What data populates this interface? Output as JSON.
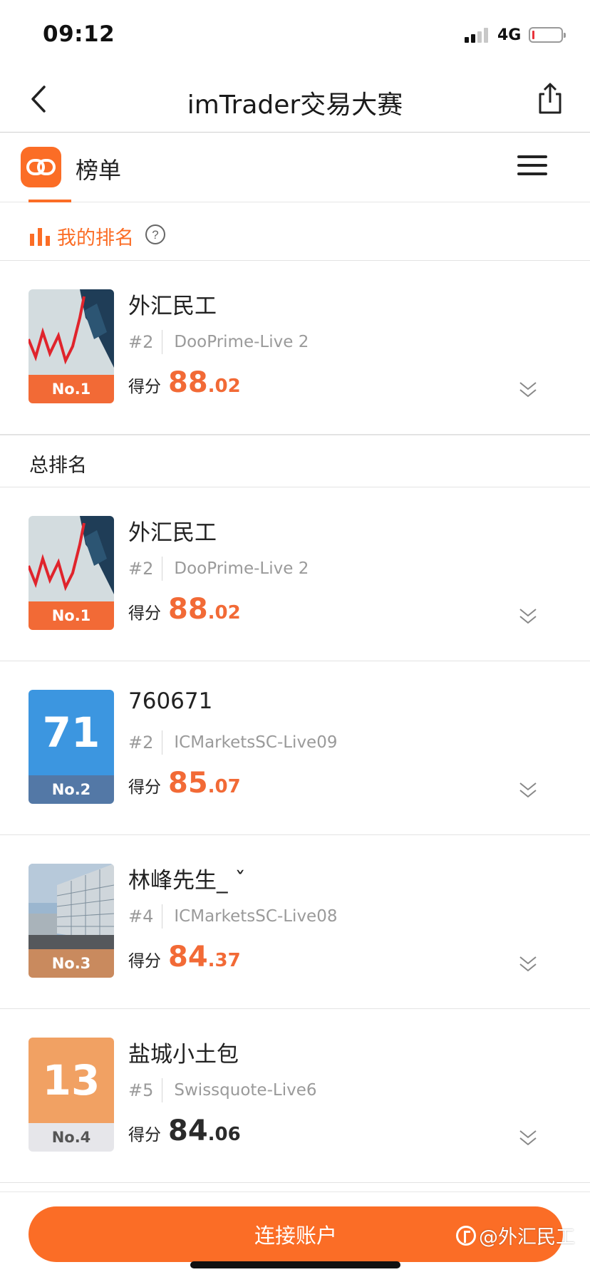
{
  "status_bar": {
    "time": "09:12",
    "network": "4G"
  },
  "nav": {
    "title": "imTrader交易大赛"
  },
  "app_header": {
    "label": "榜单"
  },
  "my_rank": {
    "label": "我的排名"
  },
  "overall": {
    "label": "总排名"
  },
  "score_label": "得分",
  "my_entry": {
    "name": "外汇民工",
    "rank": "#2",
    "server": "DooPrime-Live 2",
    "badge": "No.1",
    "score_int": "88",
    "score_dec": ".02"
  },
  "entries": [
    {
      "name": "外汇民工",
      "rank": "#2",
      "server": "DooPrime-Live 2",
      "badge": "No.1",
      "score_int": "88",
      "score_dec": ".02"
    },
    {
      "name": "760671",
      "rank": "#2",
      "server": "ICMarketsSC-Live09",
      "badge": "No.2",
      "avatar_text": "71",
      "score_int": "85",
      "score_dec": ".07"
    },
    {
      "name": "林峰先生_ ˇ",
      "rank": "#4",
      "server": "ICMarketsSC-Live08",
      "badge": "No.3",
      "score_int": "84",
      "score_dec": ".37"
    },
    {
      "name": "盐城小土包",
      "rank": "#5",
      "server": "Swissquote-Live6",
      "badge": "No.4",
      "avatar_text": "13",
      "score_int": "84",
      "score_dec": ".06"
    }
  ],
  "connect_button": "连接账户",
  "watermark": "@外汇民工",
  "colors": {
    "accent": "#fb6d26",
    "score": "#f26a36",
    "badge_gold": "#f26a36",
    "badge_silver": "#5378a6",
    "badge_bronze": "#c98a5e",
    "badge_plain": "#e6e6ea",
    "avatar_blue": "#3c96e0",
    "avatar_orange": "#f1a163"
  },
  "icons": [
    "back-arrow-icon",
    "share-icon",
    "app-logo-icon",
    "menu-icon",
    "bar-chart-icon",
    "help-icon",
    "chevron-down-icon"
  ]
}
